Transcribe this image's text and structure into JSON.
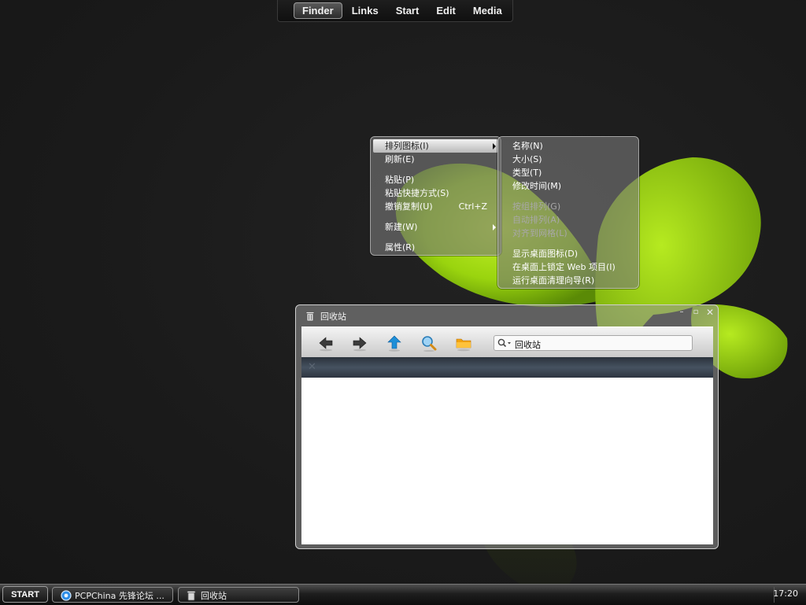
{
  "top_menu": {
    "items": [
      {
        "label": "Finder",
        "active": true
      },
      {
        "label": "Links"
      },
      {
        "label": "Start"
      },
      {
        "label": "Edit"
      },
      {
        "label": "Media"
      }
    ]
  },
  "context_menu": {
    "items": [
      {
        "label": "排列图标(I)",
        "submenu": true,
        "highlighted": true
      },
      {
        "label": "刷新(E)"
      },
      {
        "label": "粘贴(P)"
      },
      {
        "label": "粘贴快捷方式(S)"
      },
      {
        "label": "撤销复制(U)",
        "shortcut": "Ctrl+Z"
      },
      {
        "label": "新建(W)",
        "submenu": true
      },
      {
        "label": "属性(R)"
      }
    ]
  },
  "submenu": {
    "items": [
      {
        "label": "名称(N)"
      },
      {
        "label": "大小(S)"
      },
      {
        "label": "类型(T)"
      },
      {
        "label": "修改时间(M)"
      },
      {
        "label": "按组排列(G)",
        "disabled": true
      },
      {
        "label": "自动排列(A)",
        "disabled": true
      },
      {
        "label": "对齐到网格(L)",
        "disabled": true
      },
      {
        "label": "显示桌面图标(D)"
      },
      {
        "label": "在桌面上锁定 Web 项目(I)"
      },
      {
        "label": "运行桌面清理向导(R)"
      }
    ]
  },
  "explorer": {
    "title": "回收站",
    "search_value": "回收站",
    "tab_close": "✕",
    "toolbar": [
      "back-icon",
      "forward-icon",
      "up-icon",
      "search-icon",
      "folder-icon"
    ],
    "window_controls": [
      "minimize",
      "maximize",
      "close"
    ]
  },
  "taskbar": {
    "start_label": "START",
    "tasks": [
      {
        "label": "PCPChina 先锋论坛 ...",
        "icon": "ie-icon"
      },
      {
        "label": "回收站",
        "icon": "recycle-bin-icon"
      }
    ],
    "clock": "17:20"
  },
  "colors": {
    "leaf_green": "#a8e010",
    "desktop_bg": "#1c1c1c"
  }
}
